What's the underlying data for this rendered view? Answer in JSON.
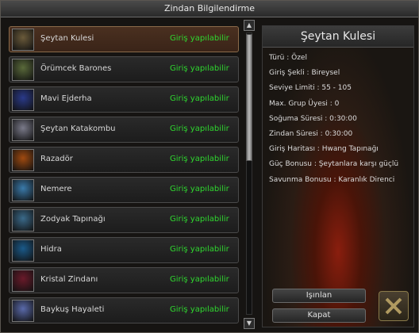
{
  "window": {
    "title": "Zindan Bilgilendirme"
  },
  "dungeons": [
    {
      "name": "Şeytan Kulesi",
      "status": "Giriş yapılabilir",
      "selected": true,
      "icon": "tower-icon",
      "color": "#6a5a3a"
    },
    {
      "name": "Örümcek Barones",
      "status": "Giriş yapılabilir",
      "selected": false,
      "icon": "spider-icon",
      "color": "#5a6a3a"
    },
    {
      "name": "Mavi Ejderha",
      "status": "Giriş yapılabilir",
      "selected": false,
      "icon": "dragon-icon",
      "color": "#2a3a8a"
    },
    {
      "name": "Şeytan Katakombu",
      "status": "Giriş yapılabilir",
      "selected": false,
      "icon": "demon-icon",
      "color": "#7a7a8a"
    },
    {
      "name": "Razadör",
      "status": "Giriş yapılabilir",
      "selected": false,
      "icon": "fire-dragon-icon",
      "color": "#a04a10"
    },
    {
      "name": "Nemere",
      "status": "Giriş yapılabilir",
      "selected": false,
      "icon": "ice-dragon-icon",
      "color": "#3a7aaa"
    },
    {
      "name": "Zodyak Tapınağı",
      "status": "Giriş yapılabilir",
      "selected": false,
      "icon": "zodiac-icon",
      "color": "#3a6a8a"
    },
    {
      "name": "Hidra",
      "status": "Giriş yapılabilir",
      "selected": false,
      "icon": "hydra-icon",
      "color": "#1a5a8a"
    },
    {
      "name": "Kristal Zindanı",
      "status": "Giriş yapılabilir",
      "selected": false,
      "icon": "crystal-icon",
      "color": "#6a1a2a"
    },
    {
      "name": "Baykuş Hayaleti",
      "status": "Giriş yapılabilir",
      "selected": false,
      "icon": "owl-icon",
      "color": "#5a6aaa"
    }
  ],
  "detail": {
    "title": "Şeytan Kulesi",
    "props": [
      "Türü : Özel",
      "Giriş Şekli : Bireysel",
      "Seviye Limiti : 55 - 105",
      "Max. Grup Üyesi : 0",
      "Soğuma Süresi : 0:30:00",
      "Zindan Süresi : 0:30:00",
      "Giriş Haritası : Hwang Tapınağı",
      "Güç Bonusu : Şeytanlara karşı güçlü",
      "Savunma Bonusu : Karanlık Direnci"
    ],
    "teleport_label": "Işınlan",
    "close_label": "Kapat"
  },
  "colors": {
    "status_green": "#2fd82f",
    "selected_row": "#4a3020"
  }
}
